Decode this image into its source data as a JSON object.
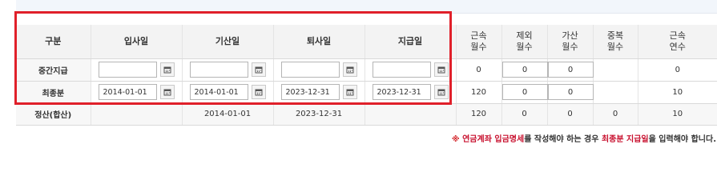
{
  "headers": {
    "category": "구분",
    "hire_date": "입사일",
    "start_date": "기산일",
    "leave_date": "퇴사일",
    "pay_date": "지급일",
    "service_months_l1": "근속",
    "service_months_l2": "월수",
    "excluded_months_l1": "제외",
    "excluded_months_l2": "월수",
    "added_months_l1": "가산",
    "added_months_l2": "월수",
    "dup_months_l1": "중복",
    "dup_months_l2": "월수",
    "service_years_l1": "근속",
    "service_years_l2": "연수"
  },
  "rows": {
    "interim": {
      "label": "중간지급",
      "hire_date": "",
      "start_date": "",
      "leave_date": "",
      "pay_date": "",
      "service_months": "0",
      "excluded_months": "0",
      "added_months": "0",
      "dup_months": "",
      "service_years": "0"
    },
    "final": {
      "label": "최종분",
      "hire_date": "2014-01-01",
      "start_date": "2014-01-01",
      "leave_date": "2023-12-31",
      "pay_date": "2023-12-31",
      "service_months": "120",
      "excluded_months": "0",
      "added_months": "0",
      "dup_months": "",
      "service_years": "10"
    },
    "settlement": {
      "label": "정산(합산)",
      "hire_date": "",
      "start_date": "2014-01-01",
      "leave_date": "2023-12-31",
      "pay_date": "",
      "service_months": "120",
      "excluded_months": "0",
      "added_months": "0",
      "dup_months": "0",
      "service_years": "10"
    }
  },
  "notice": {
    "mark": "※",
    "part1": "연금계좌 입금명세",
    "part2": "를 작성해야 하는 경우",
    "part3": "최종분 지급일",
    "part4": "을 입력해야 합니다."
  },
  "colors": {
    "highlight_box": "#e0202a",
    "notice_highlight": "#c8102e"
  },
  "icons": {
    "date_picker": "calendar-icon"
  }
}
